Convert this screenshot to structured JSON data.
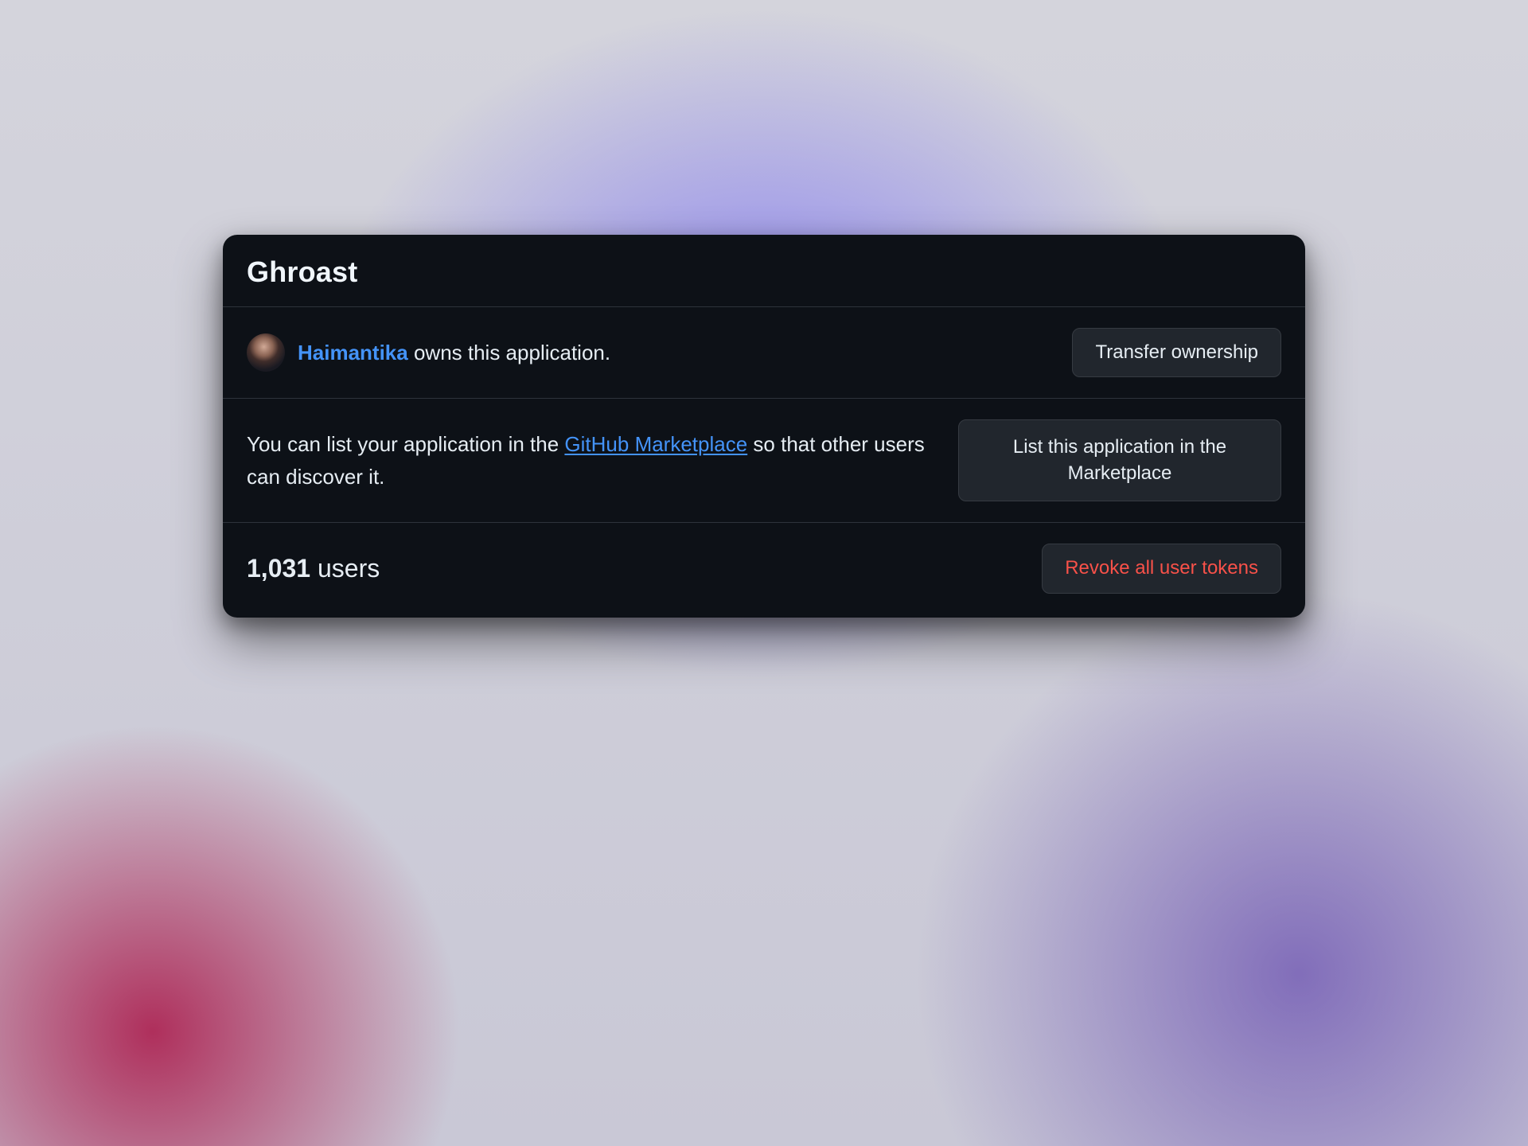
{
  "app": {
    "title": "Ghroast"
  },
  "owner": {
    "name": "Haimantika",
    "suffix": " owns this application.",
    "transfer_button": "Transfer ownership"
  },
  "marketplace": {
    "text_before": "You can list your application in the ",
    "link_text": "GitHub Marketplace",
    "text_after": " so that other users can discover it.",
    "list_button": "List this application in the Marketplace"
  },
  "users": {
    "count": "1,031",
    "label": " users",
    "revoke_button": "Revoke all user tokens"
  },
  "colors": {
    "bg_card": "#0d1117",
    "link": "#4493f8",
    "danger": "#f85149",
    "button_bg": "#21262d"
  }
}
